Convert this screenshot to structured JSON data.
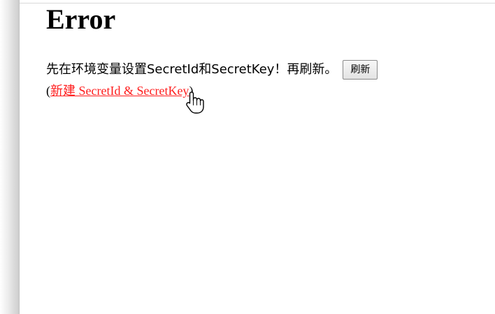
{
  "page": {
    "title": "Error"
  },
  "message": {
    "text": "先在环境变量设置SecretId和SecretKey！再刷新。",
    "refresh_button": "刷新"
  },
  "link": {
    "open_paren": "(",
    "label": "新建 SecretId & SecretKey",
    "close_paren": ")"
  },
  "icons": {
    "cursor": "hand-pointer-icon"
  },
  "colors": {
    "link": "#ff1e1e",
    "text": "#000000",
    "background": "#ffffff"
  }
}
